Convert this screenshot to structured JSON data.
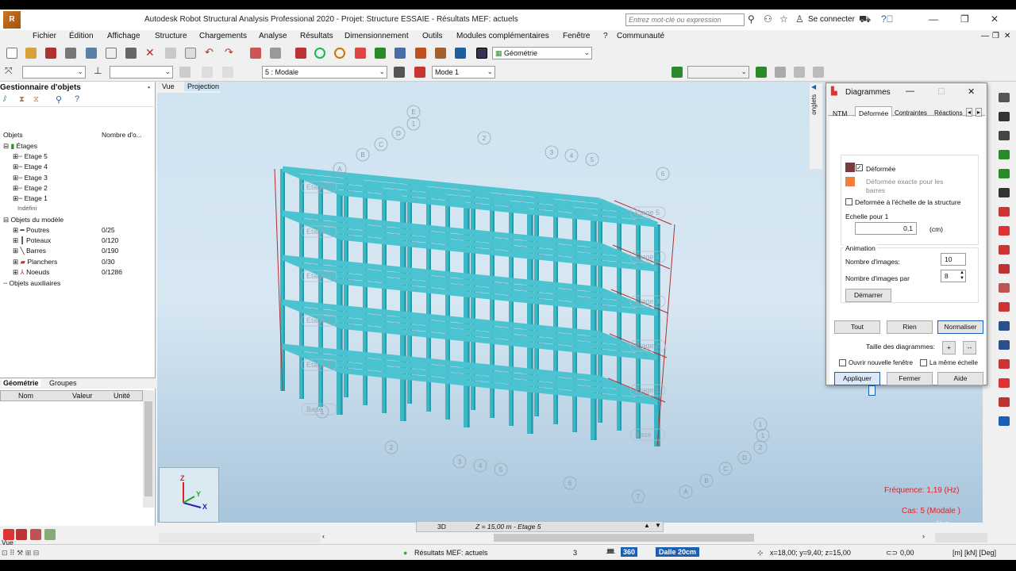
{
  "titlebar": {
    "title": "Autodesk Robot Structural Analysis Professional 2020 - Projet: Structure ESSAIE  - Résultats MEF: actuels",
    "search_placeholder": "Entrez mot-clé ou expression",
    "signin": "Se connecter",
    "logo_text": "R"
  },
  "menu": [
    "Fichier",
    "Édition",
    "Affichage",
    "Structure",
    "Chargements",
    "Analyse",
    "Résultats",
    "Dimensionnement",
    "Outils",
    "Modules complémentaires",
    "Fenêtre",
    "?",
    "Communauté"
  ],
  "toolbar": {
    "layout_combo": "Géométrie",
    "case_combo": "5 : Modale",
    "mode_combo": "Mode  1"
  },
  "object_manager": {
    "title": "Gestionnaire d'objets",
    "col_objects": "Objets",
    "col_count": "Nombre d'o...",
    "floors_label": "Étages",
    "floors": [
      "Etage 5",
      "Etage 4",
      "Etage 3",
      "Etage 2",
      "Etage 1"
    ],
    "undefined_label": "Indéfini",
    "model_objects_label": "Objets du modèle",
    "model_objects": [
      {
        "label": "Poutres",
        "count": "0/25"
      },
      {
        "label": "Poteaux",
        "count": "0/120"
      },
      {
        "label": "Barres",
        "count": "0/190"
      },
      {
        "label": "Planchers",
        "count": "0/30"
      },
      {
        "label": "Noeuds",
        "count": "0/1286"
      }
    ],
    "aux_label": "Objets auxiliaires",
    "tab_geometry": "Géométrie",
    "tab_groups": "Groupes",
    "prop_headers": [
      "Nom",
      "Valeur",
      "Unité"
    ]
  },
  "viewport": {
    "tab_view": "Vue",
    "tab_projection": "Projection",
    "side_tab": "onglets",
    "axis_z": "Z",
    "axis_y": "Y",
    "axis_x": "X",
    "floor_labels_left": [
      "Etage 5",
      "Etage 4",
      "Etage 3",
      "Etage 2",
      "Etage 1",
      "Base"
    ],
    "floor_labels_right": [
      "Etage 5",
      "Etage 4",
      "Etage 3",
      "Etage 2",
      "Etage 1",
      "Base"
    ],
    "grid_labels": [
      "E",
      "1",
      "D",
      "C",
      "B",
      "A",
      "2",
      "3",
      "4",
      "5",
      "6",
      "1",
      "2",
      "3",
      "4",
      "5",
      "6",
      "7",
      "A",
      "B",
      "C",
      "D",
      "1",
      "2",
      "1"
    ],
    "frequency": "Fréquence: 1,19 (Hz)",
    "case": "Cas: 5 (Modale )",
    "view_watermark": "Vue",
    "bottom_3d": "3D",
    "bottom_level": "Z = 15,00 m - Etage 5"
  },
  "diagrams": {
    "title": "Diagrammes",
    "tabs": [
      "NTM",
      "Déformée",
      "Contraintes",
      "Réactions"
    ],
    "deformed": "Déformée",
    "exact_deformed": "Déformée exacte pour les barres",
    "scale_structure": "Deformée à l'échelle de la structure",
    "scale_for_1": "Echelle pour 1",
    "scale_value": "0,1",
    "scale_unit": "(cm)",
    "animation": "Animation",
    "num_images": "Nombre d'images:",
    "num_images_value": "10",
    "images_per": "Nombre d'images par",
    "images_per_value": "8",
    "start": "Démarrer",
    "all": "Tout",
    "none": "Rien",
    "normalize": "Normaliser",
    "diagram_size": "Taille des diagrammes:",
    "plus": "+",
    "minus": "--",
    "open_new_window": "Ouvrir nouvelle fenêtre",
    "same_scale": "La même échelle",
    "apply": "Appliquer",
    "close": "Fermer",
    "help": "Aide",
    "colors": {
      "deformed": "#7a3b3b",
      "exact": "#f08040"
    }
  },
  "status": {
    "left_view": "Vue",
    "results": "Résultats MEF: actuels",
    "count": "3",
    "zoom_value": "360",
    "slab": "Dalle 20cm",
    "coords": "x=18,00; y=9,40; z=15,00",
    "angle": "0,00",
    "units": "[m] [kN] [Deg]"
  }
}
